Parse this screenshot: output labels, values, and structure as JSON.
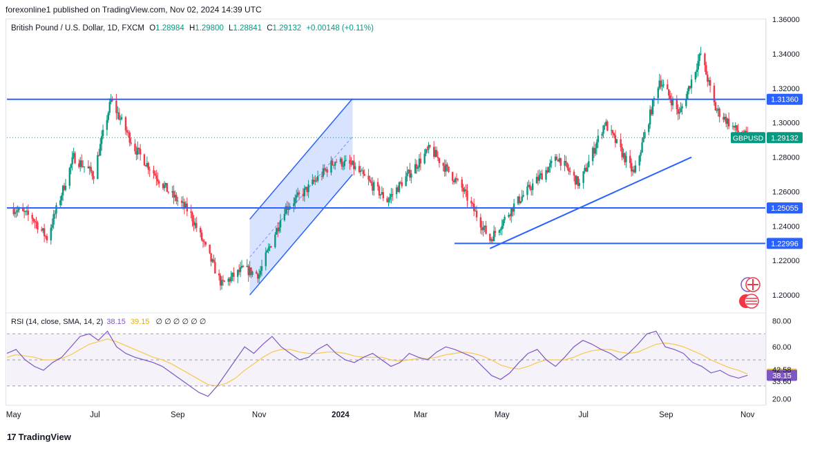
{
  "header": {
    "published": "forexonline1 published on TradingView.com, Nov 02, 2024 14:39 UTC"
  },
  "legend": {
    "symbol": "British Pound / U.S. Dollar, 1D, FXCM",
    "open_label": "O",
    "open": "1.28984",
    "high_label": "H",
    "high": "1.29800",
    "low_label": "L",
    "low": "1.28841",
    "close_label": "C",
    "close": "1.29132",
    "change": "+0.00148 (+0.11%)"
  },
  "rsi_legend": {
    "label": "RSI (14, close, SMA, 14, 2)",
    "rsi": "38.15",
    "sma": "39.15",
    "symbols": "∅ ∅ ∅ ∅ ∅ ∅"
  },
  "footer": {
    "brand": "TradingView",
    "logo": "17"
  },
  "colors": {
    "up": "#089981",
    "down": "#f23645",
    "line": "#2962ff",
    "rsi": "#7e57c2",
    "rsi_ma": "#f7c948"
  },
  "chart_data": [
    {
      "type": "candlestick",
      "symbol": "GBPUSD",
      "timeframe": "1D",
      "y_ticks": [
        "1.36000",
        "1.34000",
        "1.32000",
        "1.30000",
        "1.28000",
        "1.26000",
        "1.24000",
        "1.22000",
        "1.20000"
      ],
      "y_range": [
        1.19,
        1.36
      ],
      "x_ticks": [
        "May",
        "Jul",
        "Sep",
        "Nov",
        "2024",
        "Mar",
        "May",
        "Jul",
        "Sep",
        "Nov"
      ],
      "last_price": {
        "label": "GBPUSD",
        "value": "1.29132"
      },
      "horizontal_levels": [
        "1.31360",
        "1.25055",
        "1.22996"
      ],
      "series_close_approx": [
        {
          "t": "2023-05-01",
          "c": 1.25
        },
        {
          "t": "2023-05-15",
          "c": 1.245
        },
        {
          "t": "2023-05-26",
          "c": 1.233
        },
        {
          "t": "2023-06-15",
          "c": 1.28
        },
        {
          "t": "2023-06-30",
          "c": 1.27
        },
        {
          "t": "2023-07-13",
          "c": 1.313
        },
        {
          "t": "2023-07-31",
          "c": 1.285
        },
        {
          "t": "2023-08-25",
          "c": 1.26
        },
        {
          "t": "2023-09-10",
          "c": 1.248
        },
        {
          "t": "2023-10-04",
          "c": 1.206
        },
        {
          "t": "2023-10-20",
          "c": 1.215
        },
        {
          "t": "2023-11-01",
          "c": 1.212
        },
        {
          "t": "2023-11-20",
          "c": 1.25
        },
        {
          "t": "2023-12-05",
          "c": 1.26
        },
        {
          "t": "2023-12-28",
          "c": 1.278
        },
        {
          "t": "2024-01-10",
          "c": 1.275
        },
        {
          "t": "2024-02-05",
          "c": 1.255
        },
        {
          "t": "2024-03-08",
          "c": 1.285
        },
        {
          "t": "2024-04-01",
          "c": 1.262
        },
        {
          "t": "2024-04-22",
          "c": 1.232
        },
        {
          "t": "2024-05-10",
          "c": 1.252
        },
        {
          "t": "2024-06-12",
          "c": 1.28
        },
        {
          "t": "2024-06-28",
          "c": 1.264
        },
        {
          "t": "2024-07-17",
          "c": 1.3
        },
        {
          "t": "2024-08-08",
          "c": 1.27
        },
        {
          "t": "2024-08-27",
          "c": 1.325
        },
        {
          "t": "2024-09-11",
          "c": 1.305
        },
        {
          "t": "2024-09-27",
          "c": 1.34
        },
        {
          "t": "2024-10-08",
          "c": 1.308
        },
        {
          "t": "2024-10-23",
          "c": 1.296
        },
        {
          "t": "2024-11-01",
          "c": 1.29132
        }
      ]
    },
    {
      "type": "line",
      "title": "RSI (14, close, SMA, 14, 2)",
      "y_ticks": [
        "80.00",
        "60.00",
        "42.58",
        "33.60",
        "20.00"
      ],
      "y_range": [
        15,
        85
      ],
      "series": [
        {
          "name": "RSI",
          "last": 38.15,
          "values": [
            55,
            58,
            50,
            45,
            42,
            48,
            52,
            60,
            68,
            70,
            65,
            72,
            60,
            55,
            52,
            50,
            48,
            45,
            40,
            35,
            30,
            25,
            22,
            30,
            40,
            50,
            60,
            55,
            62,
            68,
            60,
            55,
            50,
            52,
            58,
            62,
            55,
            50,
            48,
            52,
            55,
            50,
            45,
            48,
            55,
            52,
            50,
            56,
            60,
            58,
            55,
            52,
            45,
            38,
            35,
            40,
            48,
            55,
            58,
            50,
            45,
            52,
            60,
            65,
            62,
            58,
            55,
            50,
            55,
            62,
            70,
            72,
            60,
            58,
            55,
            48,
            45,
            40,
            42,
            38,
            36,
            38.15
          ]
        },
        {
          "name": "RSI-based MA",
          "last": 39.15,
          "values": [
            52,
            54,
            53,
            52,
            50,
            50,
            51,
            54,
            58,
            62,
            64,
            66,
            64,
            61,
            58,
            55,
            52,
            50,
            47,
            43,
            39,
            35,
            31,
            30,
            32,
            36,
            42,
            47,
            52,
            56,
            58,
            58,
            56,
            55,
            55,
            56,
            56,
            55,
            53,
            52,
            52,
            52,
            50,
            49,
            50,
            51,
            51,
            52,
            54,
            55,
            56,
            55,
            53,
            50,
            46,
            44,
            43,
            45,
            48,
            50,
            50,
            50,
            52,
            55,
            57,
            58,
            58,
            56,
            55,
            56,
            59,
            62,
            63,
            62,
            60,
            57,
            54,
            50,
            47,
            44,
            42,
            39.15
          ]
        }
      ]
    }
  ]
}
